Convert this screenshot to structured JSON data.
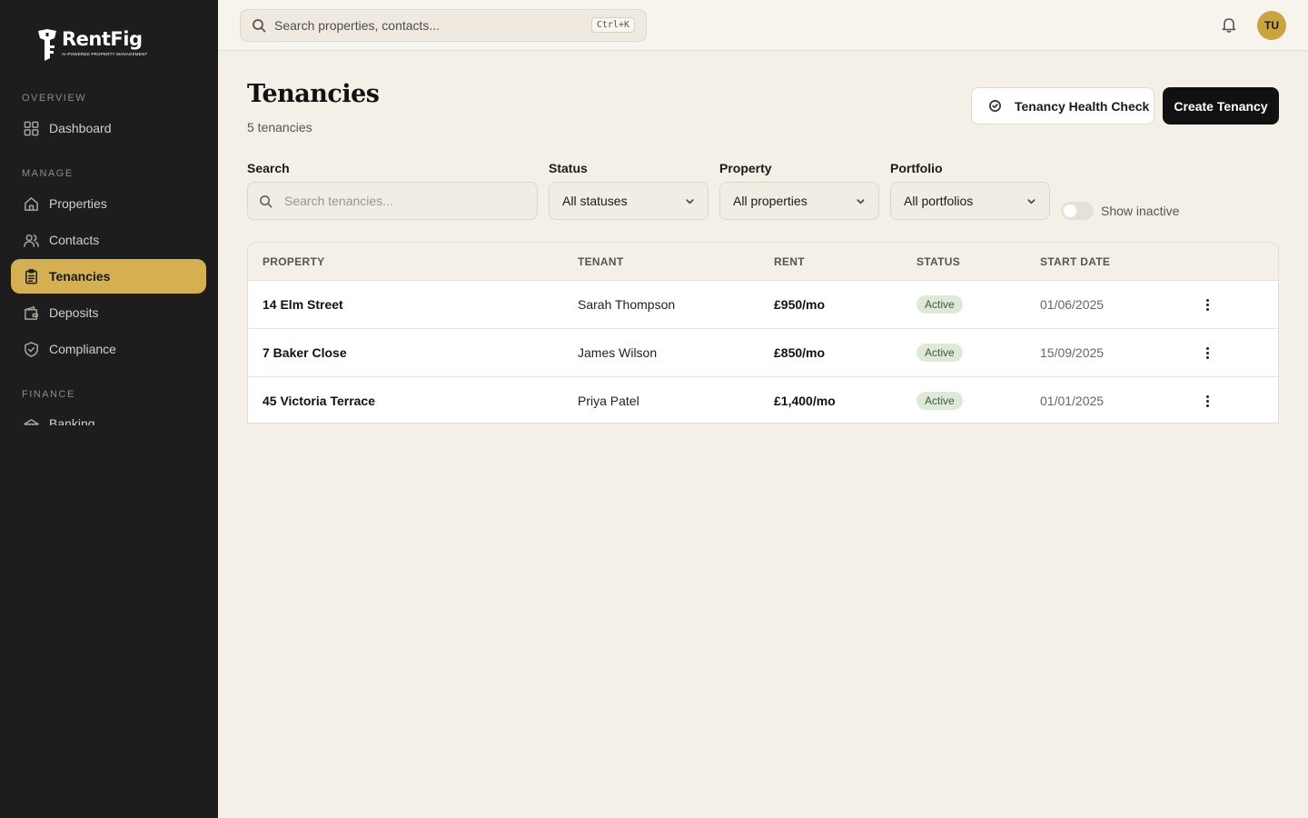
{
  "brand": {
    "name": "RentFig",
    "tagline": "AI-Powered Property Management"
  },
  "sidebar": {
    "sections": [
      {
        "label": "Overview",
        "items": [
          {
            "label": "Dashboard",
            "icon": "grid-icon"
          }
        ]
      },
      {
        "label": "Manage",
        "items": [
          {
            "label": "Properties",
            "icon": "home-icon"
          },
          {
            "label": "Contacts",
            "icon": "users-icon"
          },
          {
            "label": "Tenancies",
            "icon": "clipboard-icon",
            "active": true
          },
          {
            "label": "Deposits",
            "icon": "wallet-icon"
          },
          {
            "label": "Compliance",
            "icon": "shield-check-icon"
          }
        ]
      },
      {
        "label": "Finance",
        "items": [
          {
            "label": "Banking",
            "icon": "bank-icon"
          }
        ]
      }
    ]
  },
  "topbar": {
    "search_placeholder": "Search properties, contacts...",
    "shortcut": "Ctrl+K",
    "avatar_initials": "TU"
  },
  "page": {
    "title": "Tenancies",
    "subtitle": "5 tenancies",
    "health_check_label": "Tenancy Health Check",
    "create_label": "Create Tenancy"
  },
  "filters": {
    "search_label": "Search",
    "search_placeholder": "Search tenancies...",
    "status_label": "Status",
    "status_value": "All statuses",
    "property_label": "Property",
    "property_value": "All properties",
    "portfolio_label": "Portfolio",
    "portfolio_value": "All portfolios",
    "inactive_label": "Show inactive",
    "inactive_on": false
  },
  "table": {
    "columns": [
      "Property",
      "Tenant",
      "Rent",
      "Status",
      "Start Date"
    ],
    "rows": [
      {
        "property": "14 Elm Street",
        "tenant": "Sarah Thompson",
        "rent": "£950/mo",
        "status": "Active",
        "start": "01/06/2025"
      },
      {
        "property": "7 Baker Close",
        "tenant": "James Wilson",
        "rent": "£850/mo",
        "status": "Active",
        "start": "15/09/2025"
      },
      {
        "property": "45 Victoria Terrace",
        "tenant": "Priya Patel",
        "rent": "£1,400/mo",
        "status": "Active",
        "start": "01/01/2025"
      }
    ]
  },
  "colors": {
    "accent": "#d4b053",
    "sidebar": "#1d1d1d",
    "background": "#f4f0e8",
    "primary_button": "#111111",
    "badge_bg": "#dfe9d8"
  }
}
